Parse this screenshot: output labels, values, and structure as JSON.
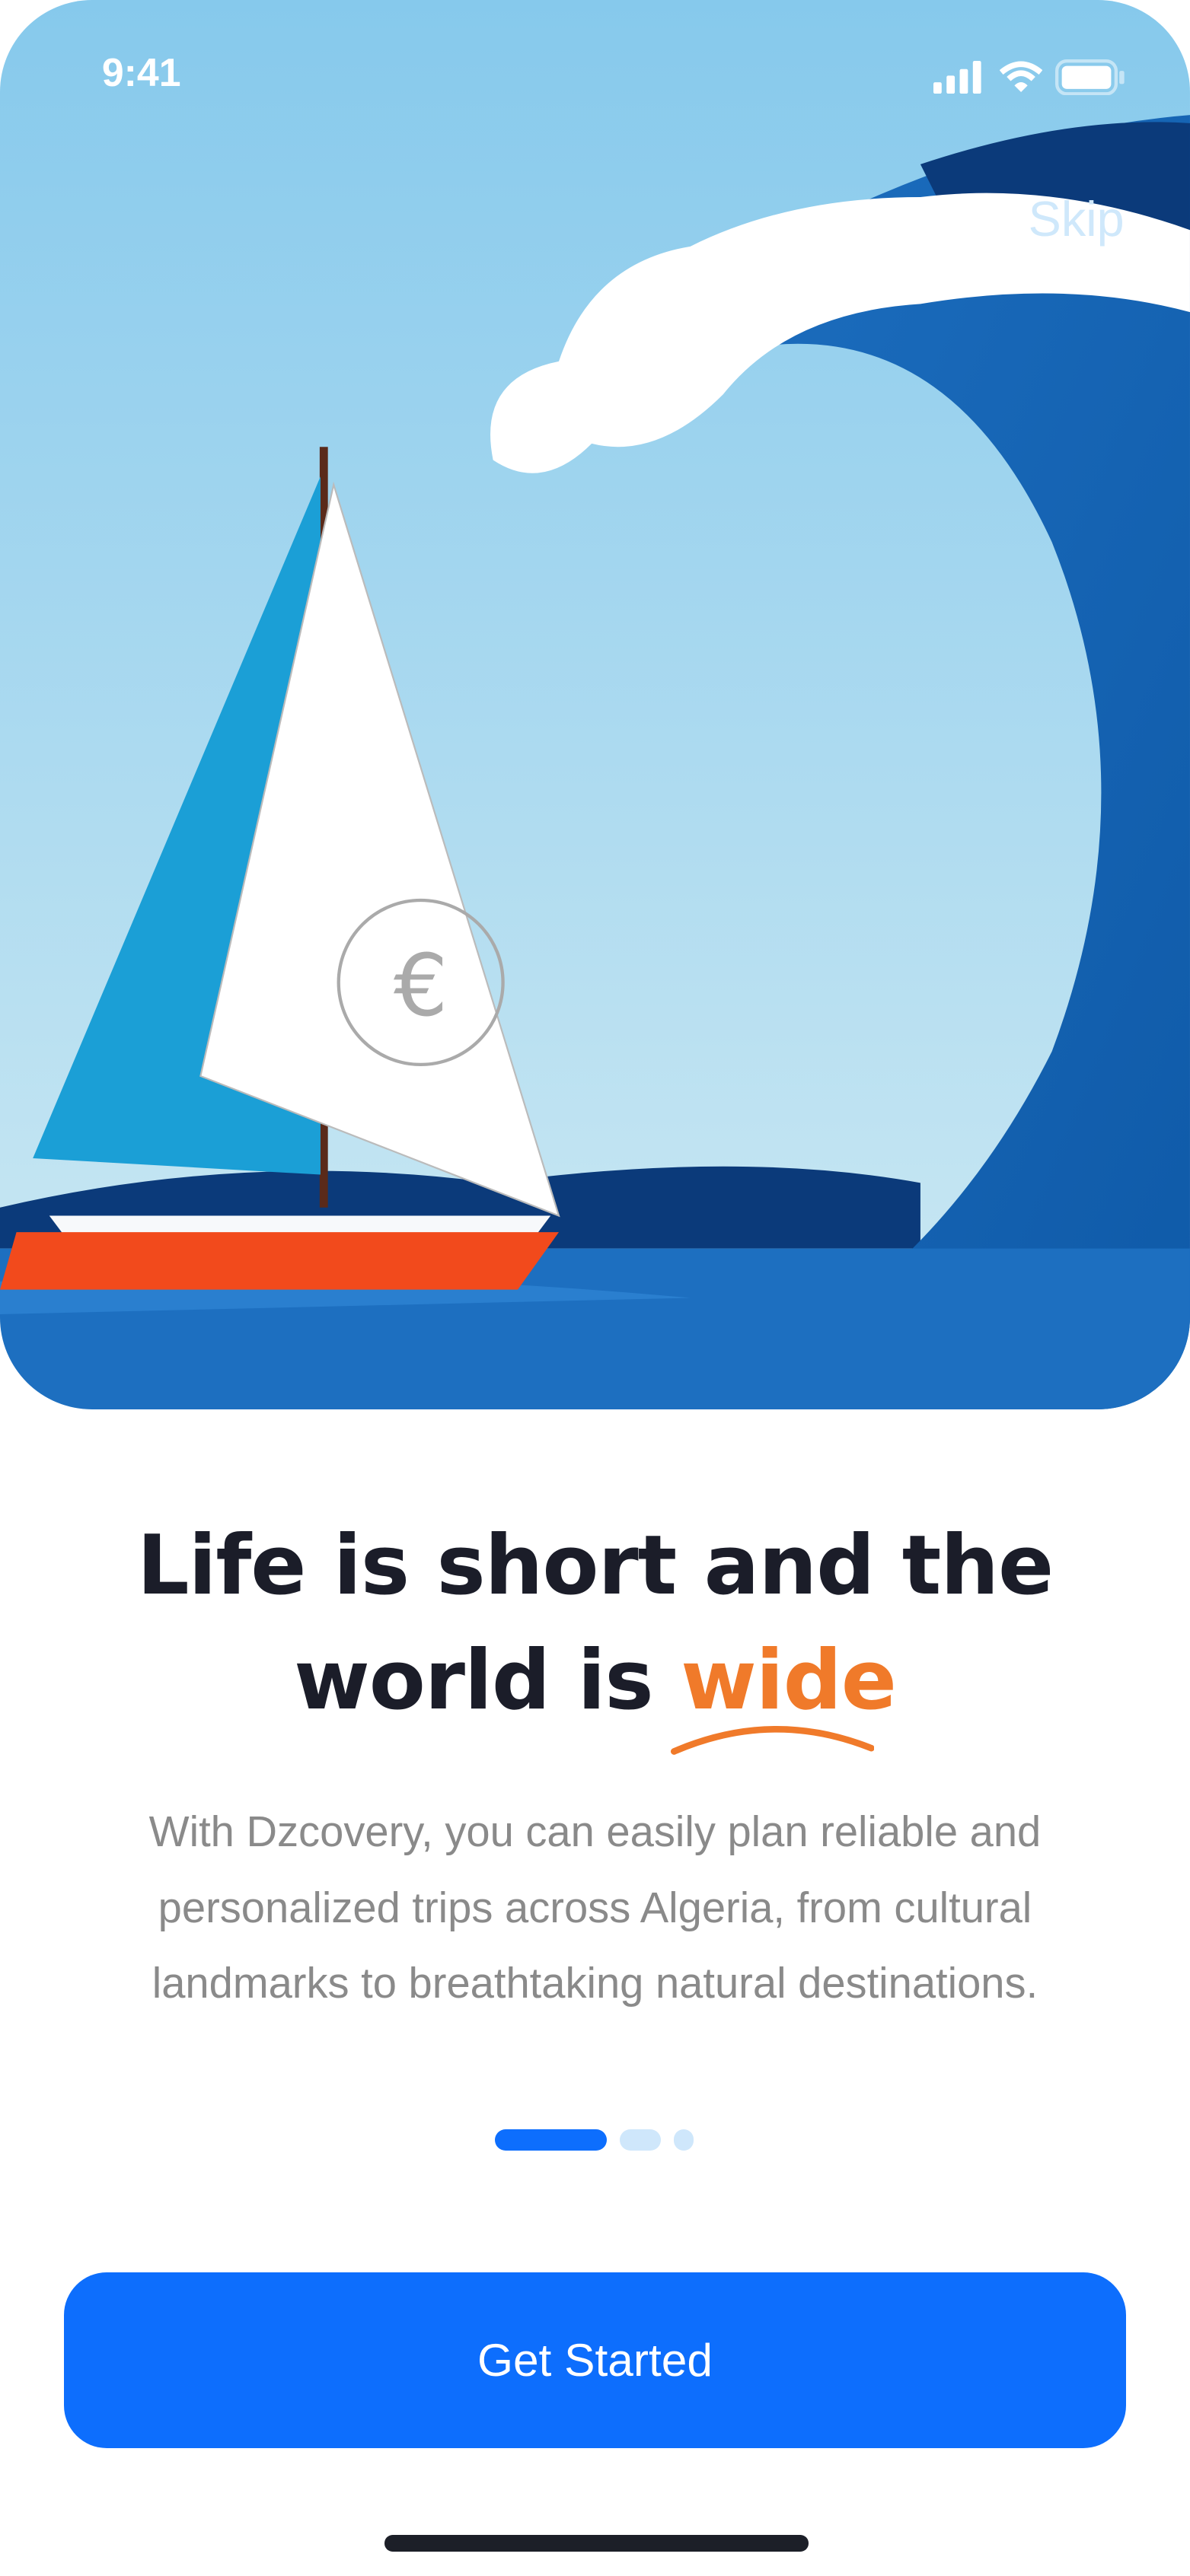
{
  "status_bar": {
    "time": "9:41"
  },
  "header": {
    "skip_label": "Skip"
  },
  "illustration": {
    "sail_symbol": "€"
  },
  "content": {
    "title_part1": "Life is short and the",
    "title_part2": "world is ",
    "title_highlight": "wide",
    "description": "With Dzcovery, you can easily plan reliable and personalized trips across Algeria, from cultural landmarks to breathtaking natural destinations."
  },
  "pagination": {
    "total": 3,
    "current": 1
  },
  "cta": {
    "label": "Get Started"
  },
  "colors": {
    "accent": "#0d6efd",
    "highlight": "#f07a2a",
    "title": "#1b1d29"
  }
}
